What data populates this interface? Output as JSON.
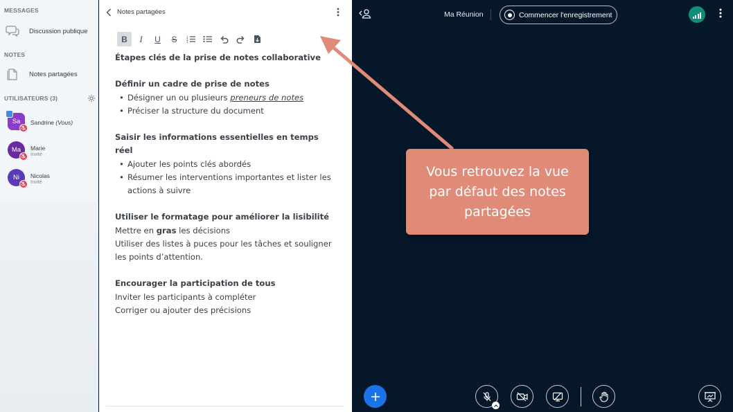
{
  "sidebar": {
    "messages_title": "MESSAGES",
    "public_chat": "Discussion publique",
    "notes_title": "NOTES",
    "shared_notes": "Notes partagées",
    "users_title": "UTILISATEURS (3)",
    "users": [
      {
        "initials": "Sa",
        "name": "Sandrine",
        "suffix": "(Vous)",
        "role": "",
        "color": "#8b3cc9"
      },
      {
        "initials": "Ma",
        "name": "Marie",
        "suffix": "",
        "role": "Invité",
        "color": "#6a2aa0"
      },
      {
        "initials": "Ni",
        "name": "Nicolas",
        "suffix": "",
        "role": "Invité",
        "color": "#5b3bb5"
      }
    ]
  },
  "notes": {
    "header_title": "Notes partagées",
    "toolbar": [
      "B",
      "I",
      "U",
      "S"
    ],
    "doc": {
      "h1": "Étapes clés de la prise de notes collaborative",
      "s1_title": "Définir un cadre de prise de notes",
      "s1_b1_prefix": "Désigner un ou plusieurs ",
      "s1_b1_emph": "preneurs de notes",
      "s1_b2": "Préciser la structure du document",
      "s2_title": "Saisir les informations essentielles en temps réel",
      "s2_b1": "Ajouter les points clés abordés",
      "s2_b2": "Résumer les interventions importantes et lister les actions à suivre",
      "s3_title": "Utiliser le formatage pour améliorer la lisibilité",
      "s3_l1_prefix": "Mettre en ",
      "s3_l1_bold": "gras",
      "s3_l1_suffix": " les décisions",
      "s3_l2": "Utiliser des listes à puces pour les tâches et souligner les points d’attention.",
      "s4_title": "Encourager la participation de tous",
      "s4_l1": "Inviter les participants à compléter",
      "s4_l2": "Corriger ou ajouter des précisions"
    }
  },
  "meeting": {
    "title": "Ma Réunion",
    "record_label": "Commencer l'enregistrement",
    "accent": "#1a73e8",
    "connection_color": "#0f8f7a"
  },
  "callout": {
    "text": "Vous retrouvez la vue par défaut des notes partagées",
    "color": "#e08a78"
  }
}
